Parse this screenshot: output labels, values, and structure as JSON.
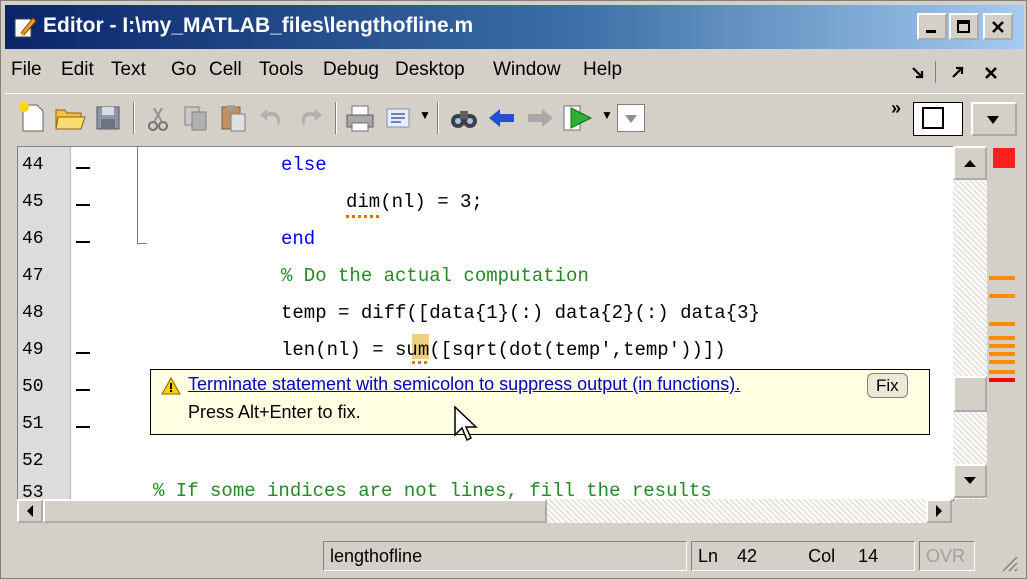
{
  "window": {
    "title": "Editor - I:\\my_MATLAB_files\\lengthofline.m"
  },
  "menu": {
    "items": [
      "File",
      "Edit",
      "Text",
      "Go",
      "Cell",
      "Tools",
      "Debug",
      "Desktop",
      "Window",
      "Help"
    ]
  },
  "editor": {
    "lines": [
      {
        "number": "44",
        "marker": true,
        "code": "else"
      },
      {
        "number": "45",
        "marker": true,
        "code": "dim(nl) = 3;"
      },
      {
        "number": "46",
        "marker": true,
        "code": "end"
      },
      {
        "number": "47",
        "marker": false,
        "code": "% Do the actual computation"
      },
      {
        "number": "48",
        "marker": false,
        "code": "temp = diff([data{1}(:) data{2}(:) data{3}"
      },
      {
        "number": "49",
        "marker": true,
        "code": "len(nl) = sum([sqrt(dot(temp',temp'))])"
      },
      {
        "number": "50",
        "marker": true,
        "code": ""
      },
      {
        "number": "51",
        "marker": true,
        "code": ""
      },
      {
        "number": "52",
        "marker": false,
        "code": ""
      },
      {
        "number": "53",
        "marker": false,
        "code": "% If some indices are not lines, fill the results"
      }
    ]
  },
  "tooltip": {
    "message": "Terminate statement with semicolon to suppress output (in functions).",
    "fix_label": "Fix",
    "hint": "Press Alt+Enter to fix."
  },
  "status": {
    "filename": "lengthofline",
    "ln_label": "Ln",
    "ln_value": "42",
    "col_label": "Col",
    "col_value": "14",
    "mode": "OVR"
  },
  "colors": {
    "keyword": "#0000ff",
    "comment": "#228b22",
    "warning_marker": "#ff8c00",
    "error_marker": "#ff0000",
    "status_indicator": "#ff2020"
  },
  "icons": [
    "matlab-editor-icon",
    "new-file-icon",
    "open-folder-icon",
    "save-icon",
    "cut-icon",
    "copy-icon",
    "paste-icon",
    "undo-icon",
    "redo-icon",
    "print-icon",
    "find-files-icon",
    "find-icon",
    "back-icon",
    "forward-icon",
    "run-icon",
    "stack-dropdown-icon",
    "undock-icon",
    "close-icon"
  ]
}
